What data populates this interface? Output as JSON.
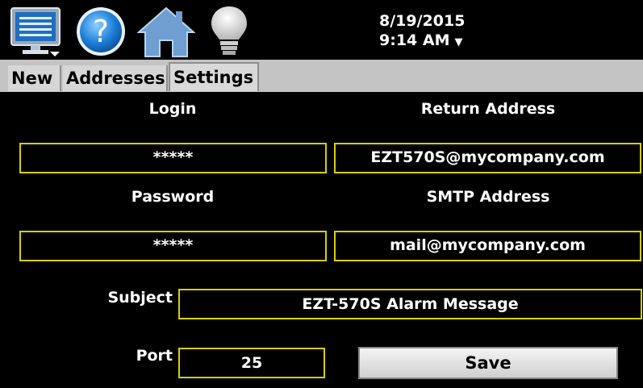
{
  "toolbar": {
    "icons": [
      "monitor-menu-icon",
      "help-icon",
      "home-icon",
      "lightbulb-icon"
    ],
    "help_glyph": "?"
  },
  "clock": {
    "date": "8/19/2015",
    "time": "9:14 AM",
    "arrow": "▼"
  },
  "tabs": [
    {
      "label": "New",
      "active": false
    },
    {
      "label": "Addresses",
      "active": false
    },
    {
      "label": "Settings",
      "active": true
    }
  ],
  "settings": {
    "login_label": "Login",
    "login_value": "*****",
    "return_address_label": "Return Address",
    "return_address_value": "EZT570S@mycompany.com",
    "password_label": "Password",
    "password_value": "*****",
    "smtp_label": "SMTP Address",
    "smtp_value": "mail@mycompany.com",
    "subject_label": "Subject",
    "subject_value": "EZT-570S Alarm Message",
    "port_label": "Port",
    "port_value": "25",
    "save_label": "Save"
  },
  "colors": {
    "background": "#000000",
    "field_border": "#d8d000",
    "tab_bar": "#c4c4c4",
    "text": "#ffffff"
  }
}
